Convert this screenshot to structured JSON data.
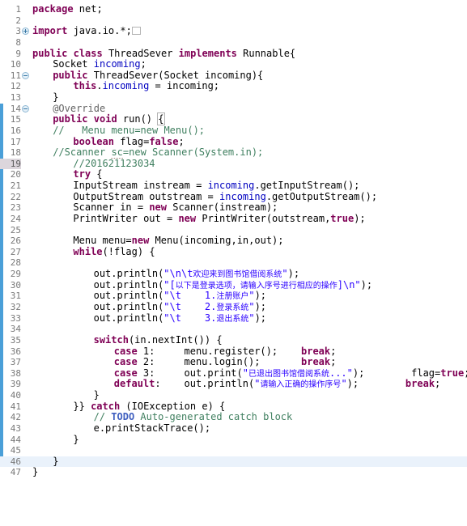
{
  "editor": {
    "name": "java-source-editor",
    "language": "Java",
    "colors": {
      "background": "#ffffff",
      "keyword": "#7f0055",
      "string": "#2a00ff",
      "comment": "#3f7f5f",
      "todo": "#3f5fbf",
      "field": "#0000c0",
      "annotation": "#646464",
      "line_number": "#787878",
      "current_line_bg": "#eaf2fb",
      "change_bar": "#4a9fd8",
      "marked_line_bg": "#dcd6dc"
    },
    "change_bar": {
      "from_line": 14,
      "to_line": 46
    },
    "current_line": 46,
    "marked_line": 19
  },
  "lines": [
    {
      "n": "1",
      "indent": 0,
      "fold": "",
      "text": "package net;"
    },
    {
      "n": "2",
      "indent": 0,
      "fold": "",
      "text": ""
    },
    {
      "n": "3",
      "indent": 0,
      "fold": "plus",
      "text": "import java.io.*;"
    },
    {
      "n": "8",
      "indent": 0,
      "fold": "",
      "text": ""
    },
    {
      "n": "9",
      "indent": 0,
      "fold": "",
      "text": "public class ThreadSever implements Runnable{"
    },
    {
      "n": "10",
      "indent": 1,
      "fold": "",
      "text": "Socket incoming;"
    },
    {
      "n": "11",
      "indent": 1,
      "fold": "minus",
      "text": "public ThreadSever(Socket incoming){"
    },
    {
      "n": "12",
      "indent": 2,
      "fold": "",
      "text": "this.incoming = incoming;"
    },
    {
      "n": "13",
      "indent": 1,
      "fold": "",
      "text": "}"
    },
    {
      "n": "14",
      "indent": 1,
      "fold": "minus",
      "text": "@Override"
    },
    {
      "n": "15",
      "indent": 1,
      "fold": "",
      "text": "public void run() {"
    },
    {
      "n": "16",
      "indent": 1,
      "fold": "",
      "text": "//   Menu menu=new Menu();"
    },
    {
      "n": "17",
      "indent": 2,
      "fold": "",
      "text": "boolean flag=false;"
    },
    {
      "n": "18",
      "indent": 1,
      "fold": "",
      "text": "//Scanner sc=new Scanner(System.in);"
    },
    {
      "n": "19",
      "indent": 2,
      "fold": "",
      "text": "//201621123034"
    },
    {
      "n": "20",
      "indent": 2,
      "fold": "",
      "text": "try {"
    },
    {
      "n": "21",
      "indent": 2,
      "fold": "",
      "text": "InputStream instream = incoming.getInputStream();"
    },
    {
      "n": "22",
      "indent": 2,
      "fold": "",
      "text": "OutputStream outstream = incoming.getOutputStream();"
    },
    {
      "n": "23",
      "indent": 2,
      "fold": "",
      "text": "Scanner in = new Scanner(instream);"
    },
    {
      "n": "24",
      "indent": 2,
      "fold": "",
      "text": "PrintWriter out = new PrintWriter(outstream,true);"
    },
    {
      "n": "25",
      "indent": 0,
      "fold": "",
      "text": ""
    },
    {
      "n": "26",
      "indent": 2,
      "fold": "",
      "text": "Menu menu=new Menu(incoming,in,out);"
    },
    {
      "n": "27",
      "indent": 2,
      "fold": "",
      "text": "while(!flag) {"
    },
    {
      "n": "28",
      "indent": 0,
      "fold": "",
      "text": ""
    },
    {
      "n": "29",
      "indent": 3,
      "fold": "",
      "text": "out.println(\"\\n\\t欢迎来到图书馆借阅系统\");"
    },
    {
      "n": "30",
      "indent": 3,
      "fold": "",
      "text": "out.println(\"[以下是登录选项，请输入序号进行相应的操作]\\n\");"
    },
    {
      "n": "31",
      "indent": 3,
      "fold": "",
      "text": "out.println(\"\\t    1.注册账户\");"
    },
    {
      "n": "32",
      "indent": 3,
      "fold": "",
      "text": "out.println(\"\\t    2.登录系统\");"
    },
    {
      "n": "33",
      "indent": 3,
      "fold": "",
      "text": "out.println(\"\\t    3.退出系统\");"
    },
    {
      "n": "34",
      "indent": 0,
      "fold": "",
      "text": ""
    },
    {
      "n": "35",
      "indent": 3,
      "fold": "",
      "text": "switch(in.nextInt()) {"
    },
    {
      "n": "36",
      "indent": 4,
      "fold": "",
      "text": "case 1:     menu.register();    break;"
    },
    {
      "n": "37",
      "indent": 4,
      "fold": "",
      "text": "case 2:     menu.login();       break;"
    },
    {
      "n": "38",
      "indent": 4,
      "fold": "",
      "text": "case 3:     out.print(\"已退出图书馆借阅系统...\");        flag=true;"
    },
    {
      "n": "39",
      "indent": 4,
      "fold": "",
      "text": "default:    out.println(\"请输入正确的操作序号\");        break;"
    },
    {
      "n": "40",
      "indent": 3,
      "fold": "",
      "text": "}"
    },
    {
      "n": "41",
      "indent": 2,
      "fold": "",
      "text": "}} catch (IOException e) {"
    },
    {
      "n": "42",
      "indent": 3,
      "fold": "",
      "text": "// TODO Auto-generated catch block"
    },
    {
      "n": "43",
      "indent": 3,
      "fold": "",
      "text": "e.printStackTrace();"
    },
    {
      "n": "44",
      "indent": 2,
      "fold": "",
      "text": "}"
    },
    {
      "n": "45",
      "indent": 0,
      "fold": "",
      "text": ""
    },
    {
      "n": "46",
      "indent": 1,
      "fold": "",
      "text": "}"
    },
    {
      "n": "47",
      "indent": 0,
      "fold": "",
      "text": "}"
    }
  ],
  "rich": {
    "l1": [
      [
        "kw",
        "package"
      ],
      [
        "pl",
        " net;"
      ]
    ],
    "l3": [
      [
        "kw",
        "import"
      ],
      [
        "pl",
        " java.io.*;"
      ],
      [
        "foldbox",
        ""
      ]
    ],
    "l9": [
      [
        "kw",
        "public"
      ],
      [
        "pl",
        " "
      ],
      [
        "kw",
        "class"
      ],
      [
        "pl",
        " ThreadSever "
      ],
      [
        "kw",
        "implements"
      ],
      [
        "pl",
        " Runnable{"
      ]
    ],
    "l10": [
      [
        "pl",
        "Socket "
      ],
      [
        "fld",
        "incoming"
      ],
      [
        "pl",
        ";"
      ]
    ],
    "l11": [
      [
        "kw",
        "public"
      ],
      [
        "pl",
        " ThreadSever(Socket incoming){"
      ]
    ],
    "l12": [
      [
        "kw",
        "this"
      ],
      [
        "pl",
        "."
      ],
      [
        "fld",
        "incoming"
      ],
      [
        "pl",
        " = incoming;"
      ]
    ],
    "l13": [
      [
        "pl",
        "}"
      ]
    ],
    "l14": [
      [
        "ann",
        "@Override"
      ]
    ],
    "l15": [
      [
        "kw",
        "public"
      ],
      [
        "pl",
        " "
      ],
      [
        "kw",
        "void"
      ],
      [
        "pl",
        " run() "
      ],
      [
        "brace",
        "{"
      ]
    ],
    "l16": [
      [
        "cmt",
        "//   Menu menu=new Menu();"
      ]
    ],
    "l17": [
      [
        "kw",
        "boolean"
      ],
      [
        "pl",
        " flag="
      ],
      [
        "kw",
        "false"
      ],
      [
        "pl",
        ";"
      ]
    ],
    "l18": [
      [
        "cmt",
        "//Scanner "
      ],
      [
        "squig",
        "sc"
      ],
      [
        "cmt",
        "=new Scanner(System.in);"
      ]
    ],
    "l19": [
      [
        "cmt",
        "//201621123034"
      ]
    ],
    "l20": [
      [
        "kw",
        "try"
      ],
      [
        "pl",
        " {"
      ]
    ],
    "l21": [
      [
        "pl",
        "InputStream instream = "
      ],
      [
        "fld",
        "incoming"
      ],
      [
        "pl",
        ".getInputStream();"
      ]
    ],
    "l22": [
      [
        "pl",
        "OutputStream outstream = "
      ],
      [
        "fld",
        "incoming"
      ],
      [
        "pl",
        ".getOutputStream();"
      ]
    ],
    "l23": [
      [
        "pl",
        "Scanner in = "
      ],
      [
        "kw",
        "new"
      ],
      [
        "pl",
        " Scanner(instream);"
      ]
    ],
    "l24": [
      [
        "pl",
        "PrintWriter out = "
      ],
      [
        "kw",
        "new"
      ],
      [
        "pl",
        " PrintWriter(outstream,"
      ],
      [
        "kw",
        "true"
      ],
      [
        "pl",
        ");"
      ]
    ],
    "l26": [
      [
        "pl",
        "Menu menu="
      ],
      [
        "kw",
        "new"
      ],
      [
        "pl",
        " Menu(incoming,in,out);"
      ]
    ],
    "l27": [
      [
        "kw",
        "while"
      ],
      [
        "pl",
        "(!flag) {"
      ]
    ],
    "l29": [
      [
        "pl",
        "out.println("
      ],
      [
        "str",
        "\"\\n\\t"
      ],
      [
        "cnstr",
        "欢迎来到图书馆借阅系统"
      ],
      [
        "str",
        "\""
      ],
      [
        "pl",
        ");"
      ]
    ],
    "l30": [
      [
        "pl",
        "out.println("
      ],
      [
        "str",
        "\"["
      ],
      [
        "cnstr",
        "以下是登录选项，请输入序号进行相应的操作"
      ],
      [
        "str",
        "]\\n\""
      ],
      [
        "pl",
        ");"
      ]
    ],
    "l31": [
      [
        "pl",
        "out.println("
      ],
      [
        "str",
        "\"\\t    1."
      ],
      [
        "cnstr",
        "注册账户"
      ],
      [
        "str",
        "\""
      ],
      [
        "pl",
        ");"
      ]
    ],
    "l32": [
      [
        "pl",
        "out.println("
      ],
      [
        "str",
        "\"\\t    2."
      ],
      [
        "cnstr",
        "登录系统"
      ],
      [
        "str",
        "\""
      ],
      [
        "pl",
        ");"
      ]
    ],
    "l33": [
      [
        "pl",
        "out.println("
      ],
      [
        "str",
        "\"\\t    3."
      ],
      [
        "cnstr",
        "退出系统"
      ],
      [
        "str",
        "\""
      ],
      [
        "pl",
        ");"
      ]
    ],
    "l35": [
      [
        "kw",
        "switch"
      ],
      [
        "pl",
        "(in.nextInt()) {"
      ]
    ],
    "l36": [
      [
        "kw",
        "case"
      ],
      [
        "pl",
        " 1:     menu.register();    "
      ],
      [
        "kw",
        "break"
      ],
      [
        "pl",
        ";"
      ]
    ],
    "l37": [
      [
        "kw",
        "case"
      ],
      [
        "pl",
        " 2:     menu.login();       "
      ],
      [
        "kw",
        "break"
      ],
      [
        "pl",
        ";"
      ]
    ],
    "l38": [
      [
        "kw",
        "case"
      ],
      [
        "pl",
        " 3:     out.print("
      ],
      [
        "str",
        "\""
      ],
      [
        "cnstr",
        "已退出图书馆借阅系统"
      ],
      [
        "str",
        "...\""
      ],
      [
        "pl",
        ");        flag="
      ],
      [
        "kw",
        "true"
      ],
      [
        "pl",
        ";"
      ]
    ],
    "l39": [
      [
        "kw",
        "default"
      ],
      [
        "pl",
        ":    out.println("
      ],
      [
        "str",
        "\""
      ],
      [
        "cnstr",
        "请输入正确的操作序号"
      ],
      [
        "str",
        "\""
      ],
      [
        "pl",
        ");        "
      ],
      [
        "kw",
        "break"
      ],
      [
        "pl",
        ";"
      ]
    ],
    "l40": [
      [
        "pl",
        "}"
      ]
    ],
    "l41": [
      [
        "pl",
        "}} "
      ],
      [
        "kw",
        "catch"
      ],
      [
        "pl",
        " (IOException e) {"
      ]
    ],
    "l42": [
      [
        "cmt",
        "// "
      ],
      [
        "todo",
        "TODO"
      ],
      [
        "cmt",
        " Auto-generated catch block"
      ]
    ],
    "l43": [
      [
        "pl",
        "e.printStackTrace();"
      ]
    ],
    "l44": [
      [
        "pl",
        "}"
      ]
    ],
    "l46": [
      [
        "pl",
        "}"
      ]
    ],
    "l47": [
      [
        "pl",
        "}"
      ]
    ]
  }
}
